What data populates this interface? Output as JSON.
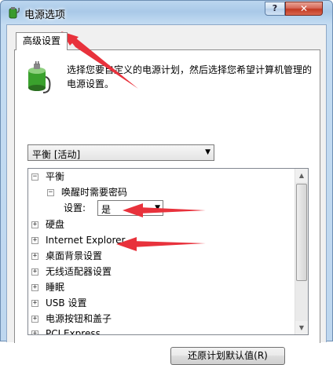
{
  "window": {
    "title": "电源选项",
    "help_label": "?",
    "close_label": "✕"
  },
  "tab": {
    "label": "高级设置"
  },
  "description": "选择您要自定义的电源计划，然后选择您希望计算机管理的电源设置。",
  "plan_select": {
    "value": "平衡 [活动]"
  },
  "tree": {
    "items": [
      {
        "expander": "−",
        "label": "平衡"
      },
      {
        "expander": "−",
        "label": "唤醒时需要密码"
      },
      {
        "expander": "",
        "label": "设置:"
      },
      {
        "expander": "+",
        "label": "硬盘"
      },
      {
        "expander": "+",
        "label": "Internet Explorer"
      },
      {
        "expander": "+",
        "label": "桌面背景设置"
      },
      {
        "expander": "+",
        "label": "无线适配器设置"
      },
      {
        "expander": "+",
        "label": "睡眠"
      },
      {
        "expander": "+",
        "label": "USB 设置"
      },
      {
        "expander": "+",
        "label": "电源按钮和盖子"
      },
      {
        "expander": "+",
        "label": "PCI Express"
      }
    ],
    "setting_select": {
      "value": "是"
    }
  },
  "restore_button": {
    "label": "还原计划默认值(R)"
  },
  "colors": {
    "annotation_arrow": "#e8323c",
    "title_gradient": "#a9c9e8"
  },
  "icons": [
    "power-plan-icon",
    "battery-plug-icon",
    "chevron-down-icon",
    "scroll-up-icon",
    "scroll-down-icon"
  ]
}
